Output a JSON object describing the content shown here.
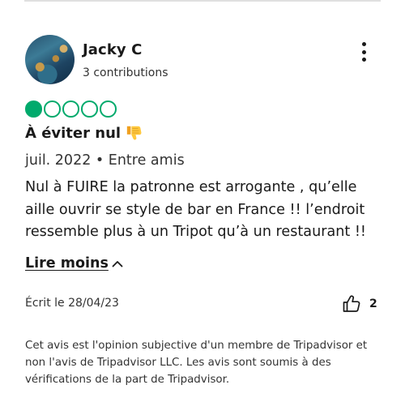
{
  "review": {
    "user": {
      "name": "Jacky C",
      "contributions": "3 contributions"
    },
    "rating": {
      "value": 1,
      "max": 5,
      "color": "#00aa6c"
    },
    "title": "À éviter nul",
    "title_emoji_icon": "thumbs-down-icon",
    "meta": "juil. 2022 • Entre amis",
    "text": "Nul à FUIRE la patronne est arrogante , qu’elle aille ouvrir se style de bar en France !! l’endroit ressemble plus à un Tripot qu’à un restaurant !!",
    "read_less_label": "Lire moins",
    "written_date": "Écrit le 28/04/23",
    "helpful_count": "2",
    "disclaimer": "Cet avis est l'opinion subjective d'un membre de Tripadvisor et non l'avis de Tripadvisor LLC. Les avis sont soumis à des vérifications de la part de Tripadvisor."
  }
}
